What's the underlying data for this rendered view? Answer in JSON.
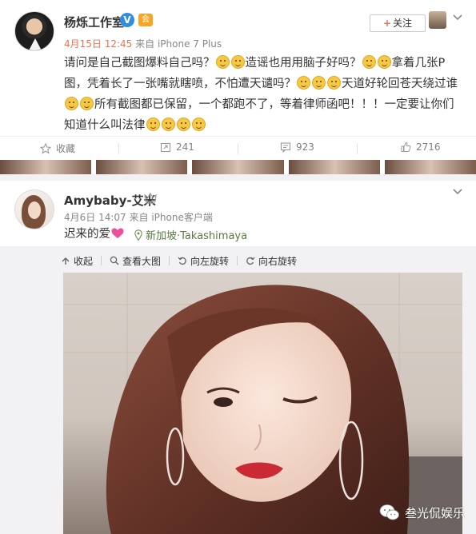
{
  "post1": {
    "username": "杨烁工作室",
    "verified_mark": "V",
    "vip_label": "会",
    "timestamp": "4月15日 12:45",
    "source": "来自 iPhone 7 Plus",
    "follow_label": "关注",
    "text_segments": [
      "请问是自己截图爆料自己吗？",
      "造谣也用用脑子好吗？",
      "拿着几张P图，凭着长了一张嘴就瞎喷，不怕遭天谴吗？",
      "天道好轮回苍天绕过谁",
      "所有截图都已保留，一个都跑不了，等着律师函吧！！！一定要让你们知道什么叫法律"
    ],
    "actions": {
      "favorite": "收藏",
      "repost": "241",
      "comment": "923",
      "like": "2716"
    }
  },
  "post2": {
    "username": "Amybaby-艾米",
    "timestamp": "4月6日 14:07",
    "source": "来自 iPhone客户端",
    "text": "迟来的爱",
    "location": "新加坡·Takashimaya",
    "toolbar": {
      "collapse": "收起",
      "view_large": "查看大图",
      "rotate_left": "向左旋转",
      "rotate_right": "向右旋转"
    }
  },
  "watermark": {
    "text": "叁光侃娱乐"
  },
  "colors": {
    "accent_orange": "#eb7350",
    "verified_blue": "#2f8ee0",
    "location_green": "#5a7a40",
    "panel_bg": "#f2f2f5"
  }
}
